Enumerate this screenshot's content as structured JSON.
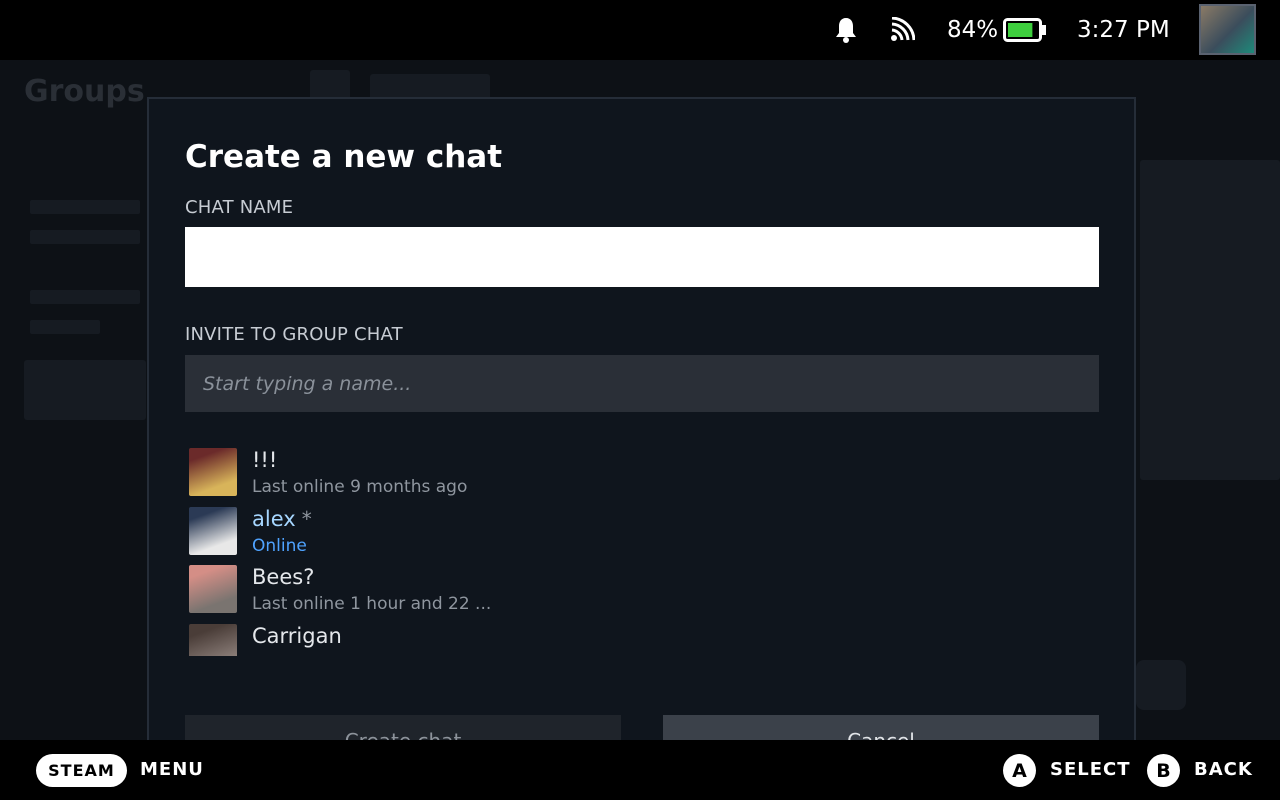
{
  "status_bar": {
    "notifications_icon": "bell-icon",
    "network_icon": "wifi-icon",
    "battery_percent": "84%",
    "battery_level": 0.84,
    "battery_color": "#3ecf3e",
    "time": "3:27 PM",
    "avatar_icon": "user-avatar"
  },
  "background": {
    "title": "Groups"
  },
  "dialog": {
    "title": "Create a new chat",
    "chat_name_label": "CHAT NAME",
    "chat_name_value": "",
    "invite_label": "INVITE TO GROUP CHAT",
    "invite_placeholder": "Start typing a name...",
    "friends": [
      {
        "name": "!!!",
        "status": "Last online 9 months ago",
        "online": false,
        "nickname": false,
        "avatar_colors": [
          "#6b2a2a",
          "#d8b45a"
        ]
      },
      {
        "name": "alex",
        "status": "Online",
        "online": true,
        "nickname": true,
        "avatar_colors": [
          "#2b3a55",
          "#e8e8e8"
        ]
      },
      {
        "name": "Bees?",
        "status": "Last online 1 hour and 22 ...",
        "online": false,
        "nickname": false,
        "avatar_colors": [
          "#d48e86",
          "#7a7470"
        ]
      },
      {
        "name": "Carrigan",
        "status": "",
        "online": false,
        "nickname": false,
        "avatar_colors": [
          "#4a3d38",
          "#8a7d78"
        ]
      }
    ],
    "nickname_marker": "*",
    "create_button": "Create chat",
    "cancel_button": "Cancel",
    "accent_online": "#4fa3ff"
  },
  "bottom_bar": {
    "steam_label": "STEAM",
    "menu_label": "MENU",
    "a_glyph": "A",
    "select_label": "SELECT",
    "b_glyph": "B",
    "back_label": "BACK"
  }
}
